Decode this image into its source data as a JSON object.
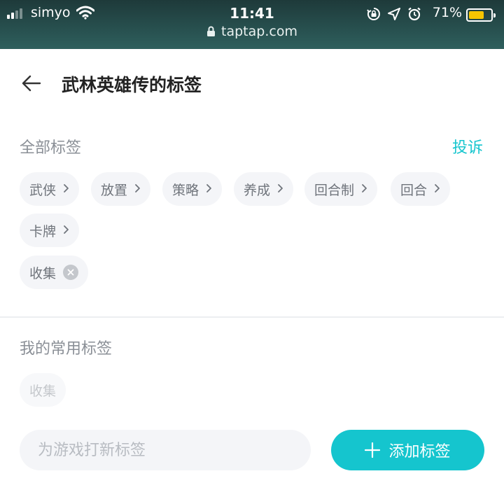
{
  "status_bar": {
    "carrier": "simyo",
    "time": "11:41",
    "battery_percent": "71%",
    "battery_level": 0.71,
    "battery_color": "#f5c500",
    "icons": [
      "signal-icon",
      "wifi-icon",
      "orientation-lock-icon",
      "location-arrow-icon",
      "alarm-icon",
      "battery-icon"
    ]
  },
  "browser": {
    "url": "taptap.com"
  },
  "header": {
    "title": "武林英雄传的标签"
  },
  "all_tags": {
    "label": "全部标签",
    "complain": "投诉",
    "tags": [
      "武侠",
      "放置",
      "策略",
      "养成",
      "回合制",
      "回合",
      "卡牌"
    ],
    "user_tags": [
      "收集"
    ]
  },
  "my_tags": {
    "label": "我的常用标签",
    "tags": [
      "收集"
    ]
  },
  "new_tag": {
    "placeholder": "为游戏打新标签",
    "value": "",
    "add_label": "添加标签"
  },
  "colors": {
    "accent": "#15c5ce",
    "chip_bg": "#f4f5f8",
    "topbar": "#2e5f5d"
  }
}
